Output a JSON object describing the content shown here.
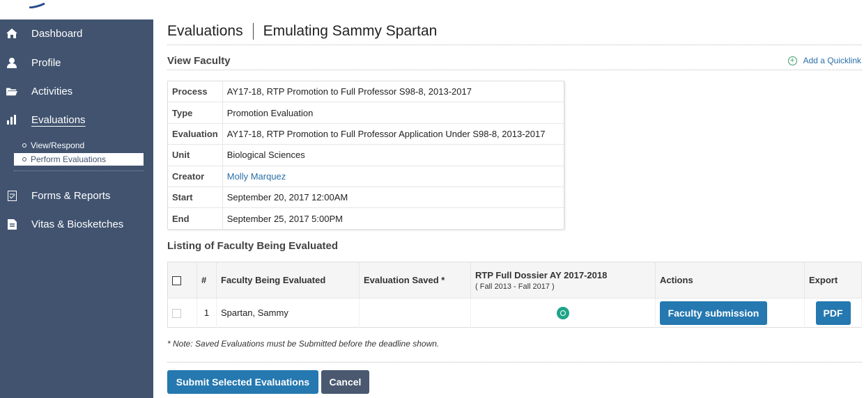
{
  "sidebar": {
    "items": [
      {
        "label": "Dashboard",
        "icon": "home-icon"
      },
      {
        "label": "Profile",
        "icon": "person-icon"
      },
      {
        "label": "Activities",
        "icon": "folder-icon"
      },
      {
        "label": "Evaluations",
        "icon": "bar-chart-icon"
      },
      {
        "label": "Forms & Reports",
        "icon": "report-icon"
      },
      {
        "label": "Vitas & Biosketches",
        "icon": "document-icon"
      }
    ],
    "sub_items": [
      {
        "label": "View/Respond"
      },
      {
        "label": "Perform Evaluations"
      }
    ]
  },
  "header": {
    "title": "Evaluations",
    "subtitle": "Emulating Sammy Spartan"
  },
  "view_faculty": {
    "heading": "View Faculty",
    "quicklink_label": "Add a Quicklink",
    "rows": [
      {
        "key": "Process",
        "value": "AY17-18, RTP Promotion to Full Professor S98-8, 2013-2017"
      },
      {
        "key": "Type",
        "value": "Promotion Evaluation"
      },
      {
        "key": "Evaluation",
        "value": "AY17-18, RTP Promotion to Full Professor Application Under S98-8, 2013-2017"
      },
      {
        "key": "Unit",
        "value": "Biological Sciences"
      },
      {
        "key": "Creator",
        "value": "Molly Marquez"
      },
      {
        "key": "Start",
        "value": "September 20, 2017 12:00AM"
      },
      {
        "key": "End",
        "value": "September 25, 2017 5:00PM"
      }
    ]
  },
  "listing": {
    "heading": "Listing of Faculty Being Evaluated",
    "columns": {
      "number": "#",
      "faculty": "Faculty Being Evaluated",
      "saved": "Evaluation Saved *",
      "dossier": "RTP Full Dossier AY 2017-2018",
      "dossier_sub": "( Fall 2013 - Fall 2017 )",
      "actions": "Actions",
      "export": "Export"
    },
    "rows": [
      {
        "number": "1",
        "faculty": "Spartan, Sammy",
        "saved": "",
        "action_label": "Faculty submission",
        "export_label": "PDF"
      }
    ]
  },
  "note": "* Note: Saved Evaluations must be Submitted before the deadline shown.",
  "buttons": {
    "submit": "Submit Selected Evaluations",
    "cancel": "Cancel"
  },
  "colors": {
    "sidebar_bg": "#41536f",
    "primary_button": "#2578b0",
    "cancel_button": "#4a5870",
    "eye_icon": "#1fa589",
    "link": "#2a6fa8"
  }
}
